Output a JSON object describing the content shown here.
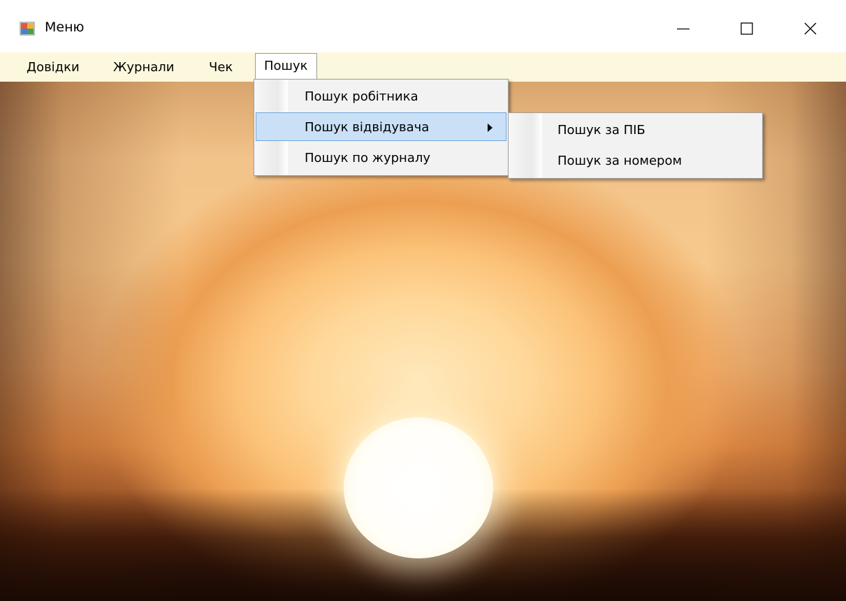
{
  "window": {
    "title": "Меню",
    "controls": {
      "minimize": "minimize-icon",
      "maximize": "maximize-icon",
      "close": "close-icon"
    }
  },
  "menubar": {
    "items": [
      {
        "label": "Довідки"
      },
      {
        "label": "Журнали"
      },
      {
        "label": "Чек"
      },
      {
        "label": "Пошук",
        "open": true
      }
    ]
  },
  "search_menu": {
    "items": [
      {
        "label": "Пошук робітника"
      },
      {
        "label": "Пошук відвідувача",
        "highlighted": true,
        "has_submenu": true
      },
      {
        "label": "Пошук по журналу"
      }
    ]
  },
  "visitor_submenu": {
    "items": [
      {
        "label": "Пошук за ПІБ"
      },
      {
        "label": "Пошук за номером"
      }
    ]
  },
  "colors": {
    "menubar_bg": "#fcf8dd",
    "highlight_bg": "#c9e0f7",
    "highlight_border": "#6ea6dc"
  }
}
